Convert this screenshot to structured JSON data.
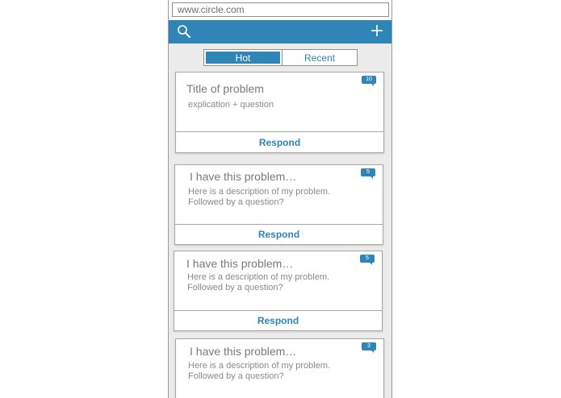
{
  "browser": {
    "url": "www.circle.com"
  },
  "appbar": {
    "search_icon": "search-icon",
    "add_icon": "plus-icon",
    "color": "#2f85b6"
  },
  "tabs": [
    {
      "label": "Hot",
      "active": true
    },
    {
      "label": "Recent",
      "active": false
    }
  ],
  "cards": [
    {
      "title": "Title of problem",
      "desc_line1": "explication + question",
      "desc_line2": "",
      "count": "10",
      "action": "Respond"
    },
    {
      "title": "I have this problem…",
      "desc_line1": "Here is a description of my problem.",
      "desc_line2": "Followed by a question?",
      "count": "5",
      "action": "Respond"
    },
    {
      "title": "I have this problem…",
      "desc_line1": "Here is a description of my problem.",
      "desc_line2": "Followed by a question?",
      "count": "5",
      "action": "Respond"
    },
    {
      "title": "I have this problem…",
      "desc_line1": "Here is a description of my problem.",
      "desc_line2": "Followed by a question?",
      "count": "3",
      "action": ""
    }
  ]
}
